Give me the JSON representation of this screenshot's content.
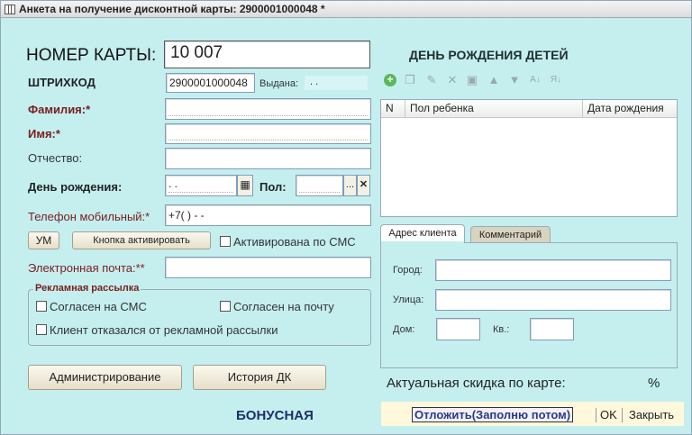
{
  "window": {
    "title": "Анкета на получение дисконтной карты: 2900001000048 *"
  },
  "card": {
    "number_label": "НОМЕР КАРТЫ:",
    "number_value": "10 007",
    "barcode_label": "ШТРИХКОД",
    "barcode_value": "2900001000048",
    "issued_label": "Выдана:",
    "issued_value": " .  ."
  },
  "person": {
    "last_name_label": "Фамилия:*",
    "last_name_value": "",
    "first_name_label": "Имя:*",
    "first_name_value": "",
    "middle_name_label": "Отчество:",
    "middle_name_value": "",
    "birthday_label": "День рождения:",
    "birthday_value": " .  .",
    "gender_label": "Пол:",
    "gender_value": "",
    "gender_select_glyph": "...",
    "gender_clear_glyph": "✕",
    "phone_label": "Телефон мобильный:*",
    "phone_value": "+7(  )   -  -",
    "email_label": "Электронная почта:**",
    "email_value": ""
  },
  "actions": {
    "um_button": "УМ",
    "activate_button": "Кнопка активировать",
    "activated_sms_label": "Активирована по СМС",
    "admin_button": "Администрирование",
    "history_button": "История ДК"
  },
  "mailing": {
    "title": "Рекламная рассылка",
    "sms_label": "Согласен на СМС",
    "mail_label": "Согласен на почту",
    "refused_label": "Клиент отказался от рекламной рассылки"
  },
  "children": {
    "title": "ДЕНЬ РОЖДЕНИЯ ДЕТЕЙ",
    "columns": [
      "N",
      "Пол ребенка",
      "Дата рождения"
    ],
    "toolbar_icons": [
      "add-icon",
      "copy-icon",
      "edit-icon",
      "delete-icon",
      "save-icon",
      "move-up-icon",
      "move-down-icon",
      "sort-asc-icon",
      "sort-desc-icon"
    ]
  },
  "address": {
    "tabs": [
      "Адрес клиента",
      "Комментарий"
    ],
    "city_label": "Город:",
    "city_value": "",
    "street_label": "Улица:",
    "street_value": "",
    "house_label": "Дом:",
    "house_value": "",
    "apt_label": "Кв.:",
    "apt_value": ""
  },
  "discount": {
    "label": "Актуальная скидка по карте:",
    "value": "",
    "unit": "%"
  },
  "bonus_label": "БОНУСНАЯ",
  "footer": {
    "postpone_button": "Отложить(Заполню потом)",
    "ok_button": "OK",
    "close_button": "Закрыть"
  }
}
